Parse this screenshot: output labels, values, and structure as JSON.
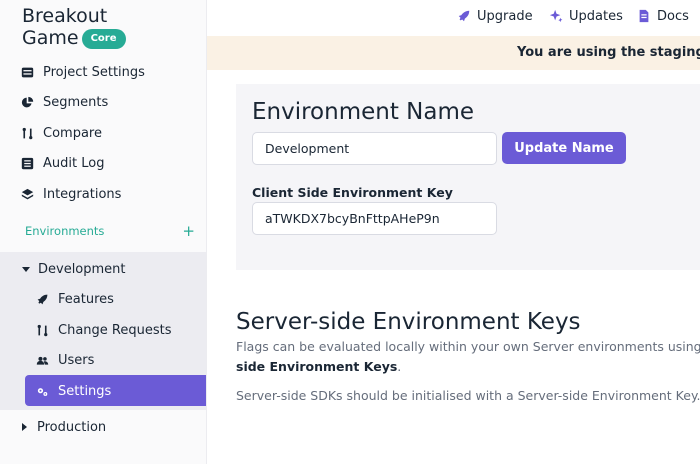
{
  "project": {
    "title_line1": "Breakout",
    "title_line2": "Game",
    "badge": "Core"
  },
  "sidebar": {
    "items": [
      {
        "label": "Project Settings",
        "icon": "settings-list-icon"
      },
      {
        "label": "Segments",
        "icon": "pie-chart-icon"
      },
      {
        "label": "Compare",
        "icon": "compare-icon"
      },
      {
        "label": "Audit Log",
        "icon": "list-icon"
      },
      {
        "label": "Integrations",
        "icon": "layers-icon"
      }
    ],
    "environments_label": "Environments",
    "add_symbol": "+",
    "environments": [
      {
        "name": "Development",
        "expanded": true,
        "items": [
          {
            "label": "Features",
            "icon": "rocket-icon"
          },
          {
            "label": "Change Requests",
            "icon": "compare-icon"
          },
          {
            "label": "Users",
            "icon": "users-icon"
          },
          {
            "label": "Settings",
            "icon": "gear-icon",
            "active": true
          }
        ]
      },
      {
        "name": "Production",
        "expanded": false
      }
    ]
  },
  "topbar": {
    "upgrade": "Upgrade",
    "updates": "Updates",
    "docs": "Docs"
  },
  "banner": {
    "text": "You are using the staging en"
  },
  "env_card": {
    "title": "Environment Name",
    "name_value": "Development",
    "update_button": "Update Name",
    "key_label": "Client Side Environment Key",
    "key_value": "aTWKDX7bcyBnFttpAHeP9n"
  },
  "server_keys": {
    "title": "Server-side Environment Keys",
    "desc_line1": "Flags can be evaluated locally within your own Server environments using ou",
    "desc_bold": "side Environment Keys",
    "desc_end": ".",
    "note": "Server-side SDKs should be initialised with a Server-side Environment Key."
  },
  "colors": {
    "accent": "#6b5bd6",
    "teal": "#27ab95",
    "banner_bg": "#faf1e4"
  }
}
